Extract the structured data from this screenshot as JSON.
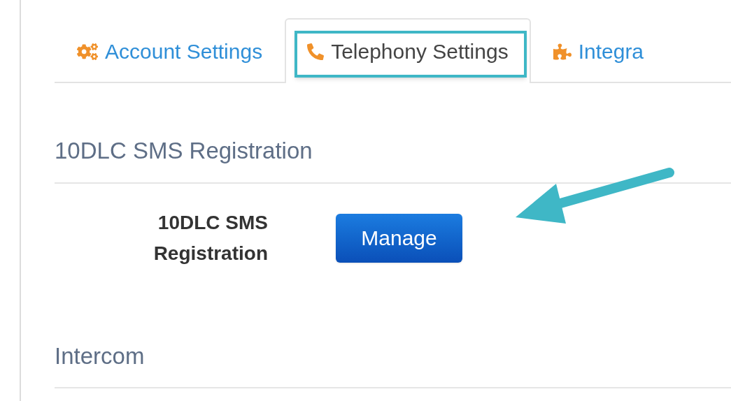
{
  "tabs": [
    {
      "label": "Account Settings",
      "kind": "gears",
      "selected": false,
      "highlighted": false
    },
    {
      "label": "Telephony Settings",
      "kind": "phone",
      "selected": true,
      "highlighted": true
    },
    {
      "label": "Integra",
      "kind": "puzzle",
      "selected": false,
      "highlighted": false
    }
  ],
  "sections": [
    {
      "title": "10DLC SMS Registration",
      "fields": [
        {
          "label": "10DLC SMS Registration",
          "button": "Manage"
        }
      ]
    },
    {
      "title": "Intercom"
    }
  ]
}
